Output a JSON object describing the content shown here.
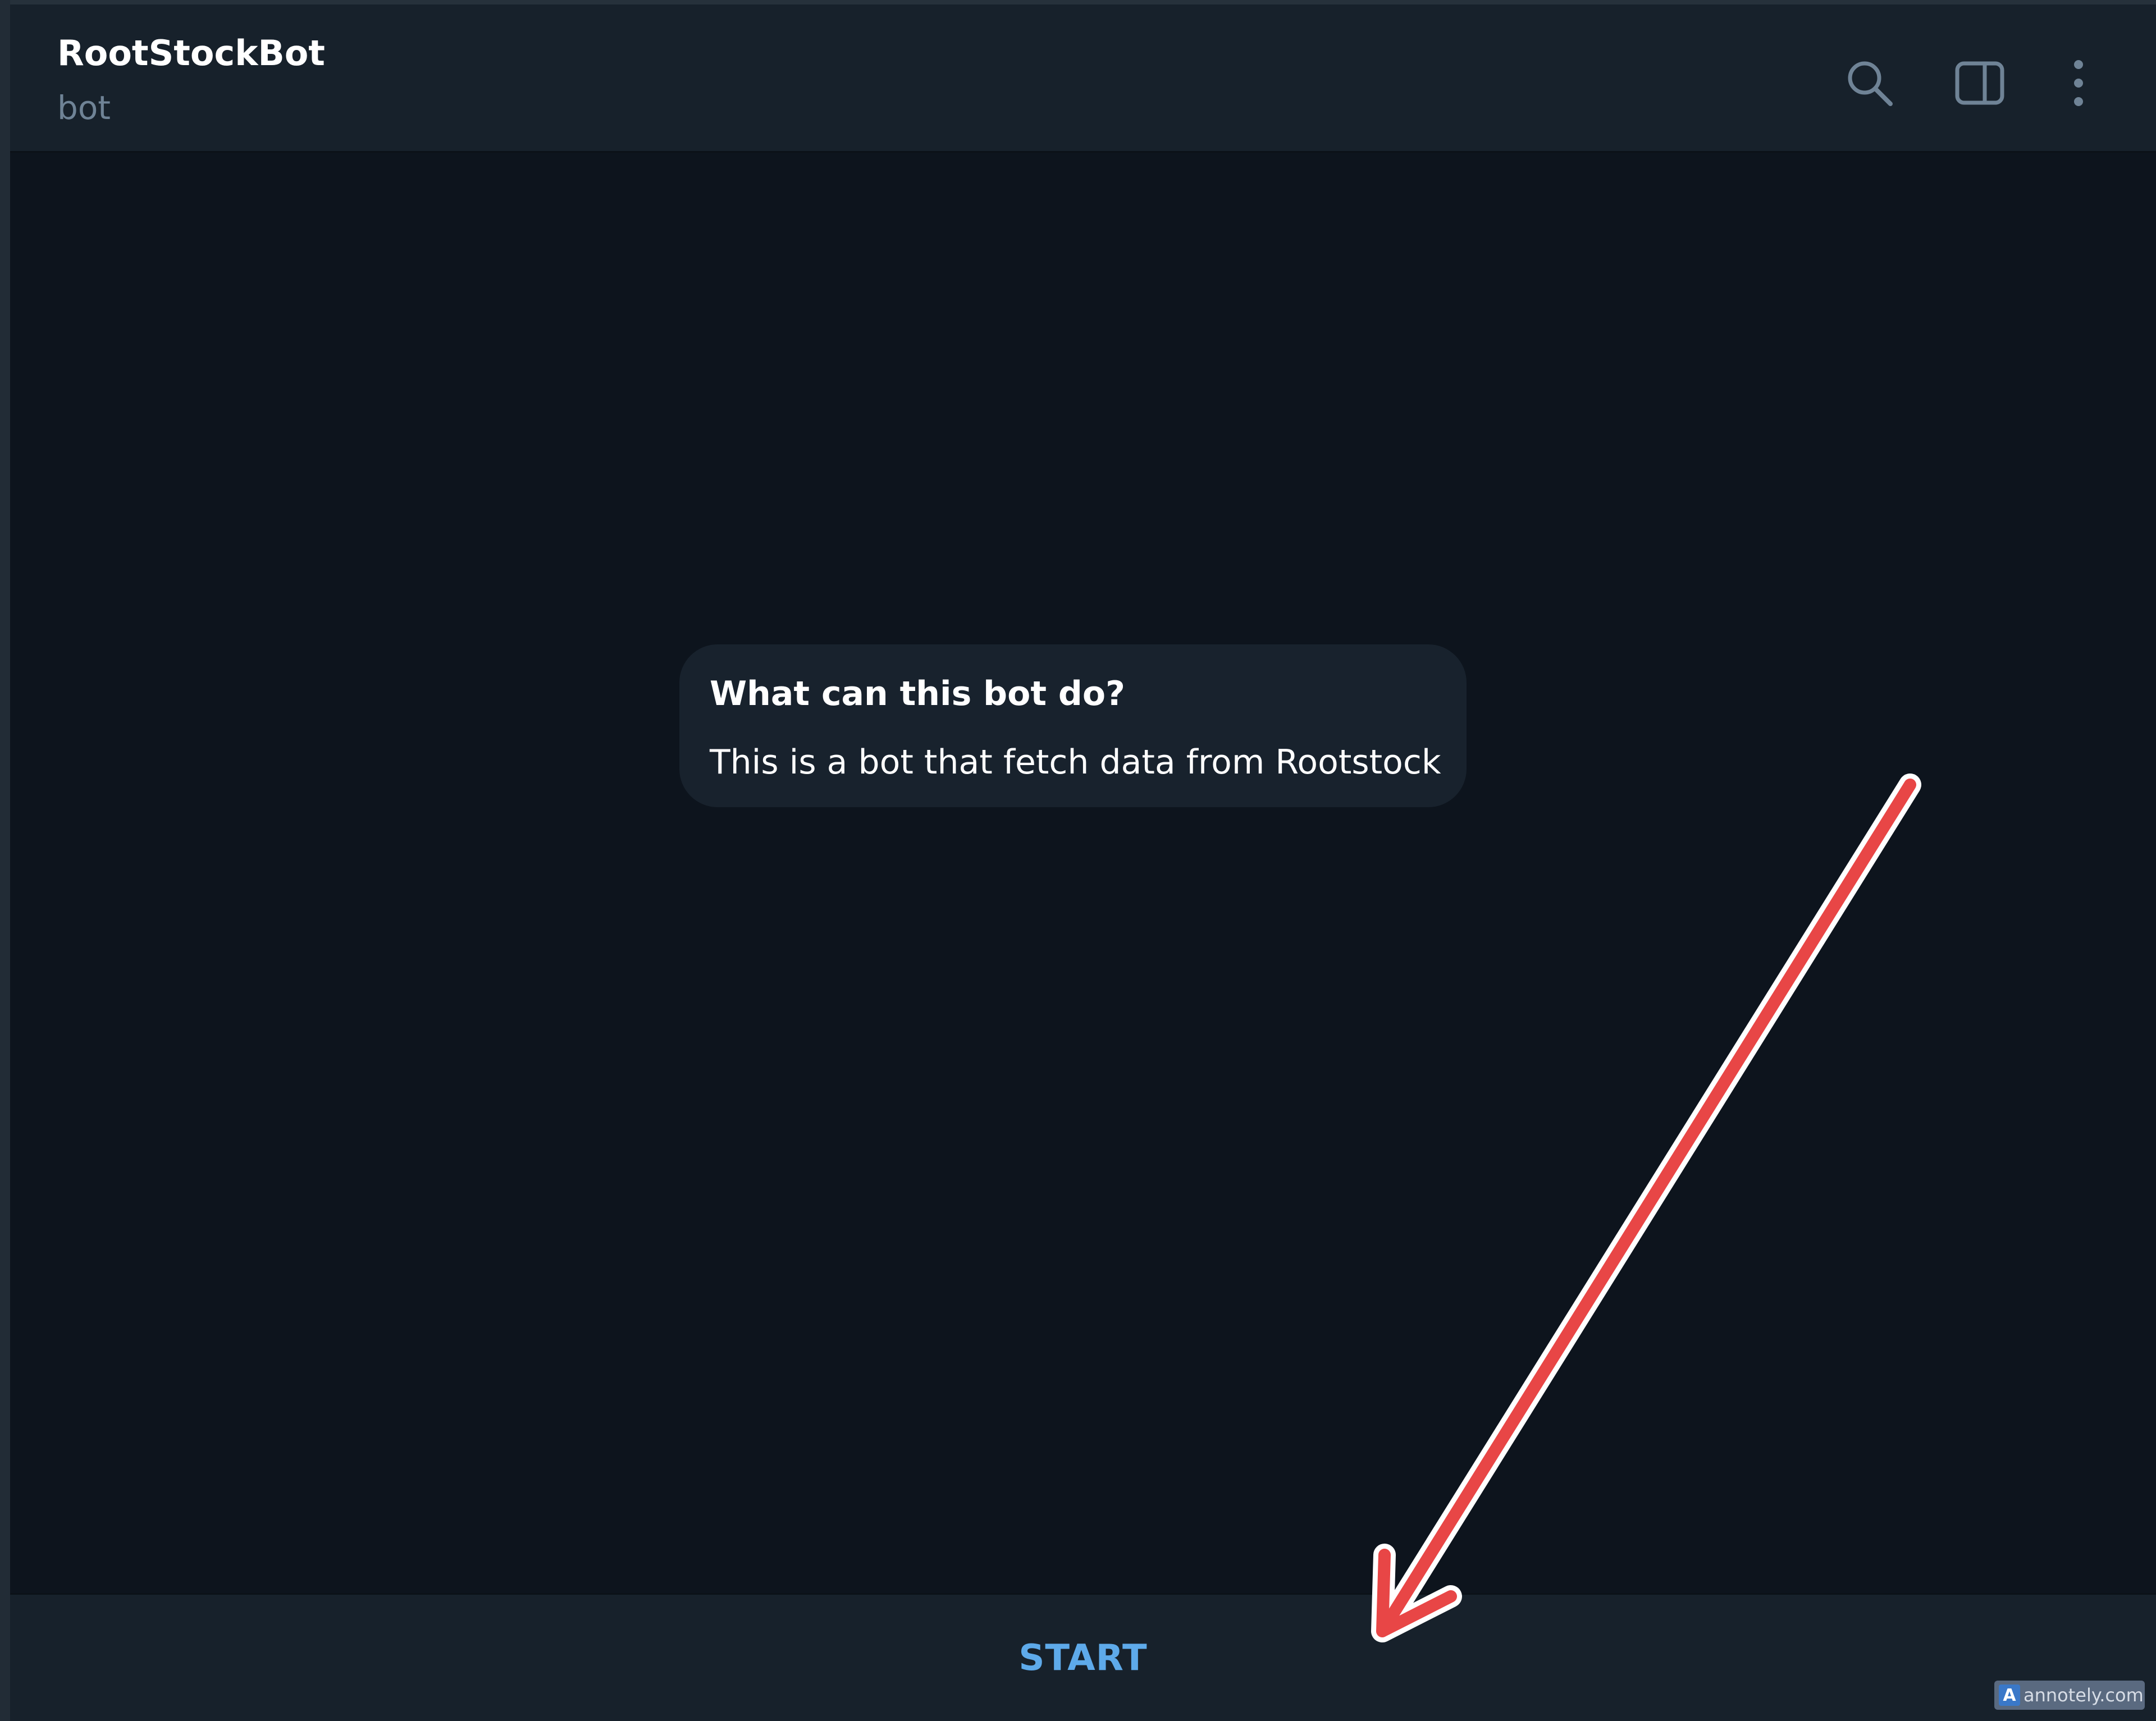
{
  "header": {
    "title": "RootStockBot",
    "subtitle": "bot",
    "icons": [
      "search-icon",
      "sidebar-toggle-icon",
      "more-vertical-icon"
    ]
  },
  "intro_card": {
    "title": "What can this bot do?",
    "text": "This is a bot that fetch data from Rootstock"
  },
  "bottom_bar": {
    "start_label": "START"
  },
  "annotation": {
    "arrow_color": "#e84646",
    "outline_color": "#ffffff"
  },
  "watermark": {
    "logo": "A",
    "text": "annotely.com"
  },
  "colors": {
    "background": "#0d141d",
    "header": "#17212b",
    "accent": "#5eaaea",
    "muted": "#6f8396"
  }
}
